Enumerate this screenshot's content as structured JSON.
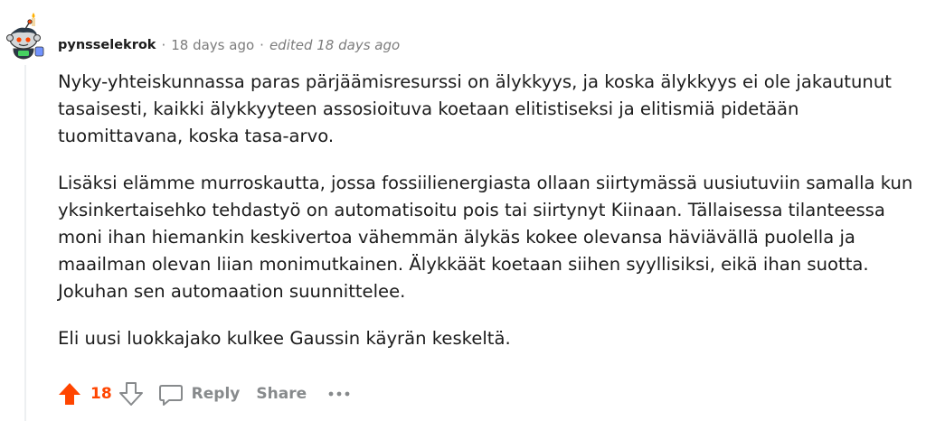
{
  "comment": {
    "username": "pynsselekrok",
    "separator": "·",
    "timestamp": "18 days ago",
    "edited": "edited 18 days ago",
    "paragraphs": [
      "Nyky-yhteiskunnassa paras pärjäämisresurssi on älykkyys, ja koska älykkyys ei ole jakautunut tasaisesti, kaikki älykkyyteen assosioituva koetaan elitistiseksi ja elitismiä pidetään tuomittavana, koska tasa-arvo.",
      "Lisäksi elämme murroskautta, jossa fossiilienergiasta ollaan siirtymässä uusiutuviin samalla kun yksinkertaisehko tehdastyö on automatisoitu pois tai siirtynyt Kiinaan. Tällaisessa tilanteessa moni ihan hiemankin keskivertoa vähemmän älykäs kokee olevansa häviävällä puolella ja maailman olevan liian monimutkainen. Älykkäät koetaan siihen syyllisiksi, eikä ihan suotta. Jokuhan sen automaation suunnittelee.",
      "Eli uusi luokkajako kulkee Gaussin käyrän keskeltä."
    ]
  },
  "actions": {
    "score": "18",
    "reply_label": "Reply",
    "share_label": "Share"
  },
  "icons": {
    "upvote": "upvote-arrow-icon",
    "downvote": "downvote-arrow-icon",
    "reply": "speech-bubble-icon",
    "more": "more-dots-icon",
    "avatar": "snoo-avatar-icon"
  },
  "colors": {
    "upvote_active": "#ff4500",
    "muted": "#878a8c",
    "meta": "#7c7c7c",
    "text": "#1c1c1c"
  }
}
